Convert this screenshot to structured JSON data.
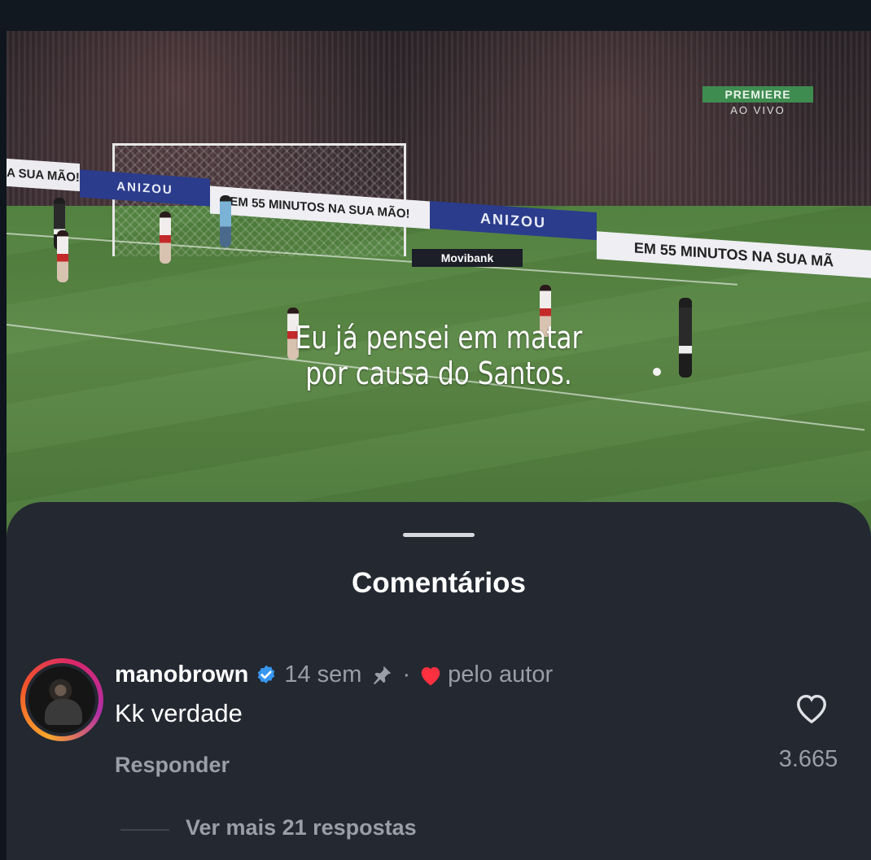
{
  "video": {
    "caption_line1": "Eu já pensei em matar",
    "caption_line2": "por causa do Santos.",
    "broadcaster_logo": "PREMIERE",
    "broadcaster_status": "AO VIVO",
    "board_texts": [
      "A SUA MÃO!",
      "ANIZOU",
      "EM 55 MINUTOS NA SUA MÃO!",
      "ANIZOU",
      "EM 55 MINUTOS NA SUA MÃ"
    ],
    "sponsor": "Movibank"
  },
  "comments_sheet": {
    "title": "Comentários",
    "comment": {
      "username": "manobrown",
      "verified": true,
      "time": "14 sem",
      "pinned_icon": "pin-icon",
      "separator": "·",
      "liked_by_author_icon": "heart-filled-icon",
      "liked_by_author_text": "pelo autor",
      "text": "Kk verdade",
      "reply_label": "Responder",
      "like_icon": "heart-outline-icon",
      "like_count": "3.665"
    },
    "more_replies": "Ver mais 21 respostas"
  },
  "colors": {
    "sheet_bg": "#232831",
    "verified_blue": "#3897f0",
    "heart_red": "#ff3040",
    "muted_text": "#9a9ea6"
  }
}
